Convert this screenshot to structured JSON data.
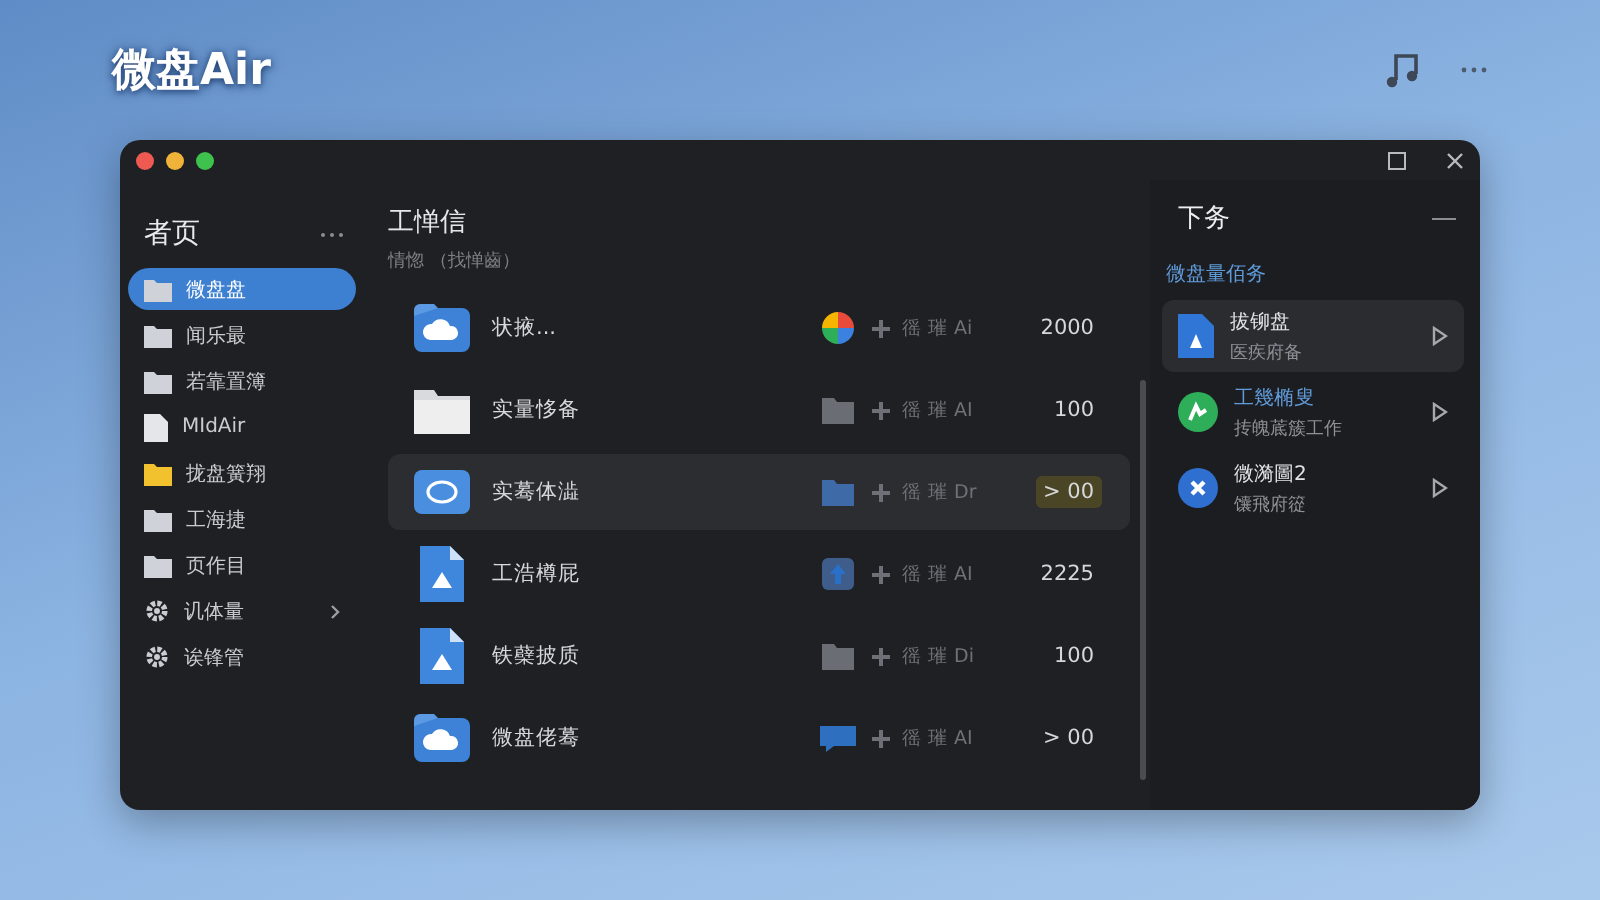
{
  "app": {
    "title": "微盘Air"
  },
  "window": {
    "sidebar": {
      "title": "者页",
      "items": [
        {
          "label": "微盘盘",
          "kind": "folder",
          "selected": true,
          "expandable": false
        },
        {
          "label": "闻乐最",
          "kind": "folder",
          "selected": false,
          "expandable": false
        },
        {
          "label": "若靠置簿",
          "kind": "folder",
          "selected": false,
          "expandable": false
        },
        {
          "label": "MIdAir",
          "kind": "doc",
          "selected": false,
          "expandable": false
        },
        {
          "label": "拢盘簧翔",
          "kind": "starred",
          "selected": false,
          "expandable": false
        },
        {
          "label": "工海捷",
          "kind": "folder",
          "selected": false,
          "expandable": false
        },
        {
          "label": "页作目",
          "kind": "folder",
          "selected": false,
          "expandable": false
        },
        {
          "label": "讥体量",
          "kind": "setting",
          "selected": false,
          "expandable": true
        },
        {
          "label": "诶锋管",
          "kind": "setting",
          "selected": false,
          "expandable": false
        }
      ]
    },
    "files": {
      "title": "工惮信",
      "subtitle": "情惚 （找惮齒）",
      "rows": [
        {
          "name": "状掖...",
          "kind": "cloud",
          "source": "徭 璀 Ai",
          "size": "2000",
          "selected": false
        },
        {
          "name": "实量恀备",
          "kind": "folder",
          "source": "徭 璀 AI",
          "size": "100",
          "selected": false
        },
        {
          "name": "实蓦体澁",
          "kind": "sync",
          "source": "徭 璀 Dr",
          "size": "> 00",
          "selected": true
        },
        {
          "name": "工浩樽屁",
          "kind": "doc",
          "source": "徭 璀 AI",
          "size": "2225",
          "selected": false
        },
        {
          "name": "铁蘗披质",
          "kind": "doc",
          "source": "徭 璀 Di",
          "size": "100",
          "selected": false
        },
        {
          "name": "微盘佬蓦",
          "kind": "cloud",
          "source": "徭 璀 AI",
          "size": "> 00",
          "selected": false
        }
      ]
    },
    "tasks": {
      "title": "下务",
      "section": "微盘量佰务",
      "items": [
        {
          "title": "拔铆盘",
          "detail": "医疾府备",
          "kind": "doc",
          "selected": true,
          "highlighted": false
        },
        {
          "title": "工幾椭叟",
          "detail": "抟魄菧簇工作",
          "kind": "chart",
          "selected": false,
          "highlighted": true
        },
        {
          "title": "微漪圖2",
          "detail": "馕飛府篵",
          "kind": "error",
          "selected": false,
          "highlighted": false
        }
      ]
    }
  }
}
